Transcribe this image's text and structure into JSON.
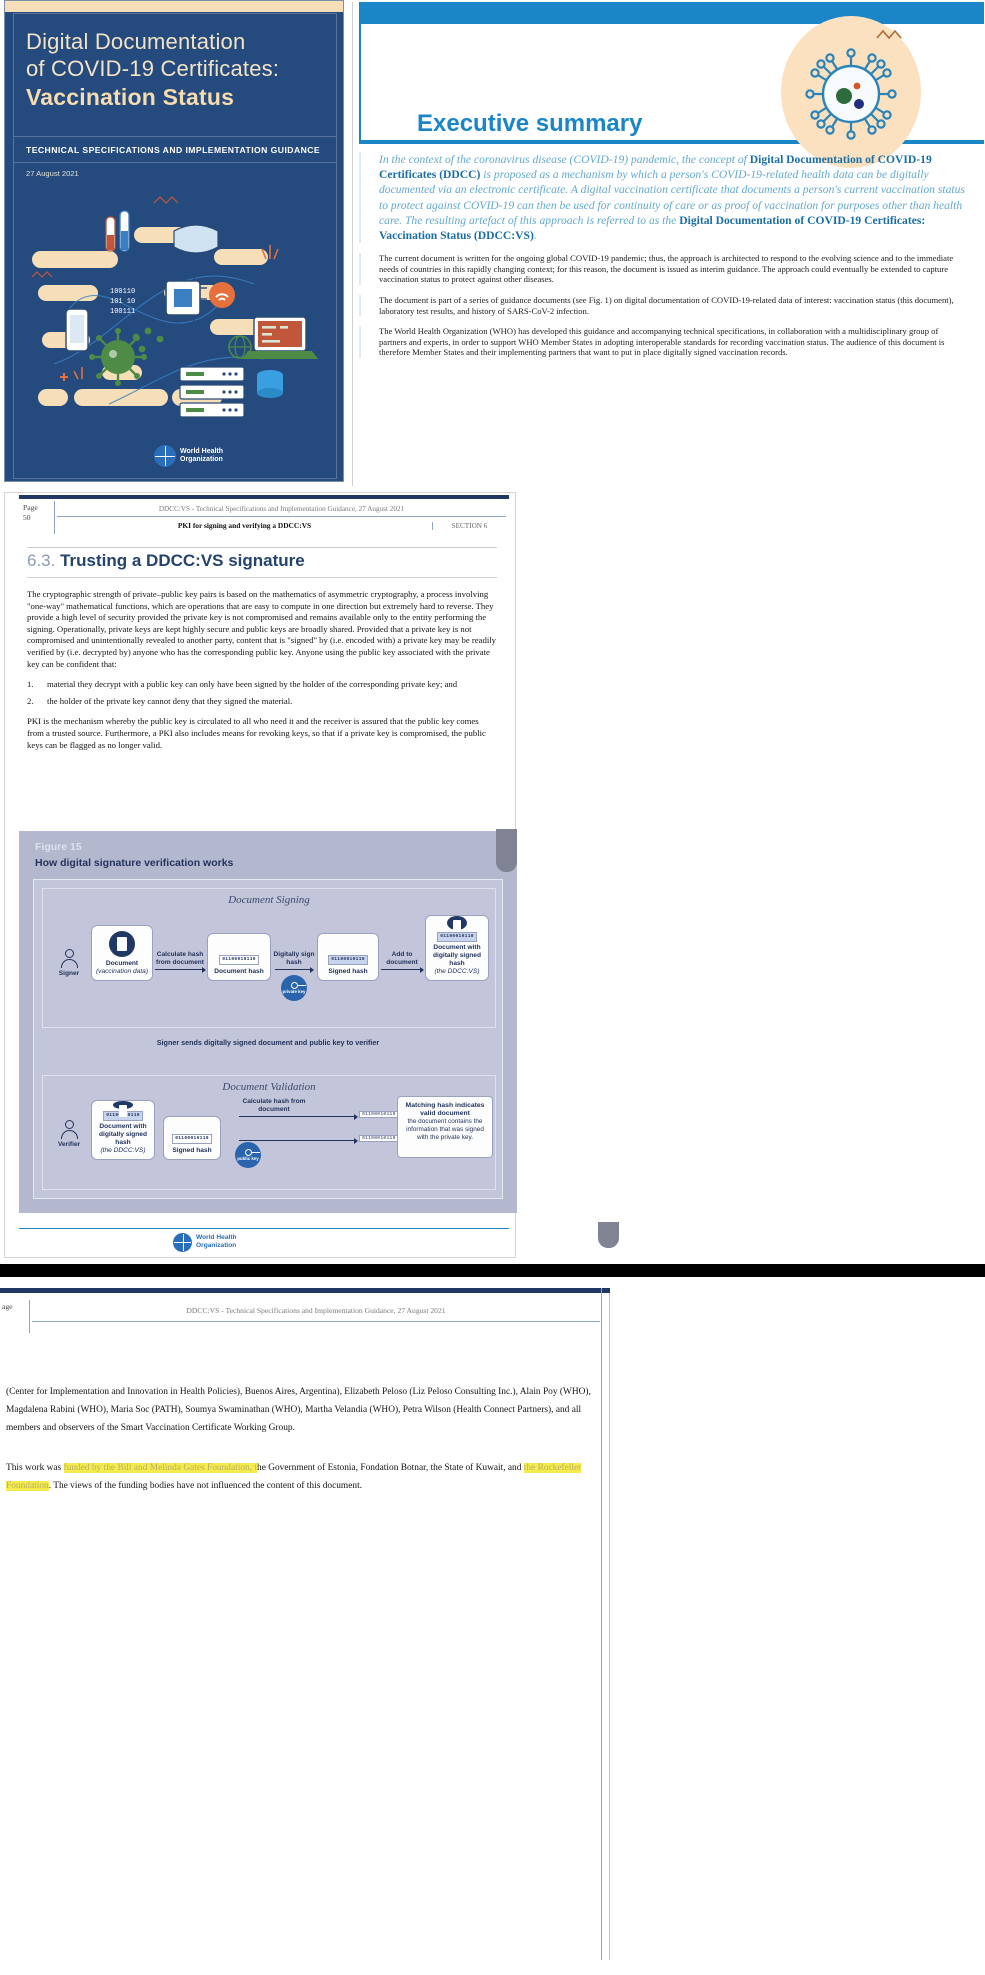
{
  "cover": {
    "title_line1": "Digital Documentation",
    "title_line2": "of COVID-19 Certificates:",
    "title_bold": "Vaccination Status",
    "subtitle": "TECHNICAL SPECIFICATIONS AND IMPLEMENTATION GUIDANCE",
    "date": "27 August 2021",
    "logo_line1": "World Health",
    "logo_line2": "Organization"
  },
  "executive": {
    "heading": "Executive summary",
    "lead_part1": "In the context of the coronavirus disease (COVID-19) pandemic, the concept of ",
    "lead_bold1": "Digital Documentation of COVID-19 Certificates (DDCC)",
    "lead_part2": " is proposed as a mechanism by which a person's COVID-19-related health data can be digitally documented via an electronic certificate. A digital vaccination certificate that documents a person's current vaccination status to protect against COVID-19 can then be used for continuity of care or as proof of vaccination for purposes other than health care. The resulting artefact of this approach is referred to as the ",
    "lead_bold2": "Digital Documentation of COVID-19 Certificates: Vaccination Status (DDCC:VS)",
    "lead_part3": ".",
    "para1": "The current document is written for the ongoing global COVID-19 pandemic; thus, the approach is architected to respond to the evolving science and to the immediate needs of countries in this rapidly changing context; for this reason, the document is issued as interim guidance. The approach could eventually be extended to capture vaccination status to protect against other diseases.",
    "para2": "The document is part of a series of guidance documents (see Fig. 1) on digital documentation of COVID-19-related data of interest: vaccination status (this document), laboratory test results, and history of SARS-CoV-2 infection.",
    "para3": "The World Health Organization (WHO) has developed this guidance and accompanying technical specifications, in collaboration with a multidisciplinary group of partners and experts, in order to support WHO Member States in adopting interoperable standards for recording vaccination status. The audience of this document is therefore Member States and their implementing partners that want to put in place digitally signed vaccination records."
  },
  "page2": {
    "page_label": "Page",
    "page_number": "50",
    "running_head": "DDCC:VS - Technical Specifications and Implementation Guidance, 27 August 2021",
    "section_title": "PKI for signing and verifying a DDCC:VS",
    "section_number": "SECTION 6",
    "heading_number": "6.3.",
    "heading_text": "Trusting a DDCC:VS signature",
    "para1": "The cryptographic strength of private–public key pairs is based on the mathematics of asymmetric cryptography, a process involving \"one-way\" mathematical functions, which are operations that are easy to compute in one direction but extremely hard to reverse. They provide a high level of security provided the private key is not compromised and remains available only to the entity performing the signing. Operationally, private keys are kept highly secure and public keys are broadly shared. Provided that a private key is not compromised and unintentionally revealed to another party, content that is \"signed\" by (i.e. encoded with) a private key may be readily verified by (i.e. decrypted by) anyone who has the corresponding public key. Anyone using the public key associated with the private key can be confident that:",
    "list": [
      {
        "num": "1.",
        "text": "material they decrypt with a public key can only have been signed by the holder of the corresponding private key; and"
      },
      {
        "num": "2.",
        "text": "the holder of the private key cannot deny that they signed the material."
      }
    ],
    "para2": "PKI is the mechanism whereby the public key is circulated to all who need it and the receiver is assured that the public key comes from a trusted source. Furthermore, a PKI also includes means for revoking keys, so that if a private key is compromised, the public keys can be flagged as no longer valid.",
    "footer_logo_line1": "World Health",
    "footer_logo_line2": "Organization"
  },
  "figure": {
    "label": "Figure 15",
    "caption": "How digital signature verification works",
    "signing_title": "Document Signing",
    "validation_title": "Document Validation",
    "middle_note": "Signer sends digitally signed document and public key to verifier",
    "signer_label": "Signer",
    "verifier_label": "Verifier",
    "private_key_label": "private key",
    "public_key_label": "public key",
    "bits_plain": "01100010110",
    "bits_signed": "01100010110",
    "nodes": {
      "document": "Document",
      "document_sub": "(vaccination data)",
      "document_hash": "Document hash",
      "signed_hash": "Signed hash",
      "doc_signed": "Document with digitally signed hash",
      "doc_signed_sub": "(the DDCC:VS)",
      "doc_signed2": "Document with digitally signed hash",
      "doc_signed2_sub": "(the DDCC:VS)",
      "signed_hash2": "Signed hash"
    },
    "arrows": {
      "a1": "Calculate hash from document",
      "a2": "Digitally sign hash",
      "a3": "Add to document",
      "a4": "Calculate hash from document"
    },
    "match_title": "Matching hash indicates valid document",
    "match_body": "the document contains the information that was signed with the private key."
  },
  "page3": {
    "page_label": "age",
    "running_head": "DDCC:VS - Technical Specifications and Implementation Guidance, 27 August 2021",
    "para1": "(Center for Implementation and Innovation in Health Policies), Buenos Aires, Argentina), Elizabeth Peloso (Liz Peloso Consulting Inc.), Alain Poy (WHO), Magdalena Rabini (WHO), Maria Soc (PATH), Soumya Swaminathan (WHO), Martha Velandia (WHO), Petra Wilson (Health Connect Partners), and all members and observers of the Smart Vaccination Certificate Working Group.",
    "para2_a": "This work was ",
    "para2_hl1": "funded by the Bill and Melinda Gates Foundation, t",
    "para2_b": "he Government of Estonia, Fondation Botnar, the State of Kuwait, and ",
    "para2_hl2": "the Rockefeller Foundation",
    "para2_c": ". The views of the funding bodies have not influenced the content of this document."
  },
  "colors": {
    "navy": "#244a7e",
    "cream": "#f6dfb8",
    "who_blue": "#1a86c8",
    "dark_navy": "#1f3864",
    "figure_bg": "#b4b8cf",
    "highlight": "#f5ec4b"
  }
}
